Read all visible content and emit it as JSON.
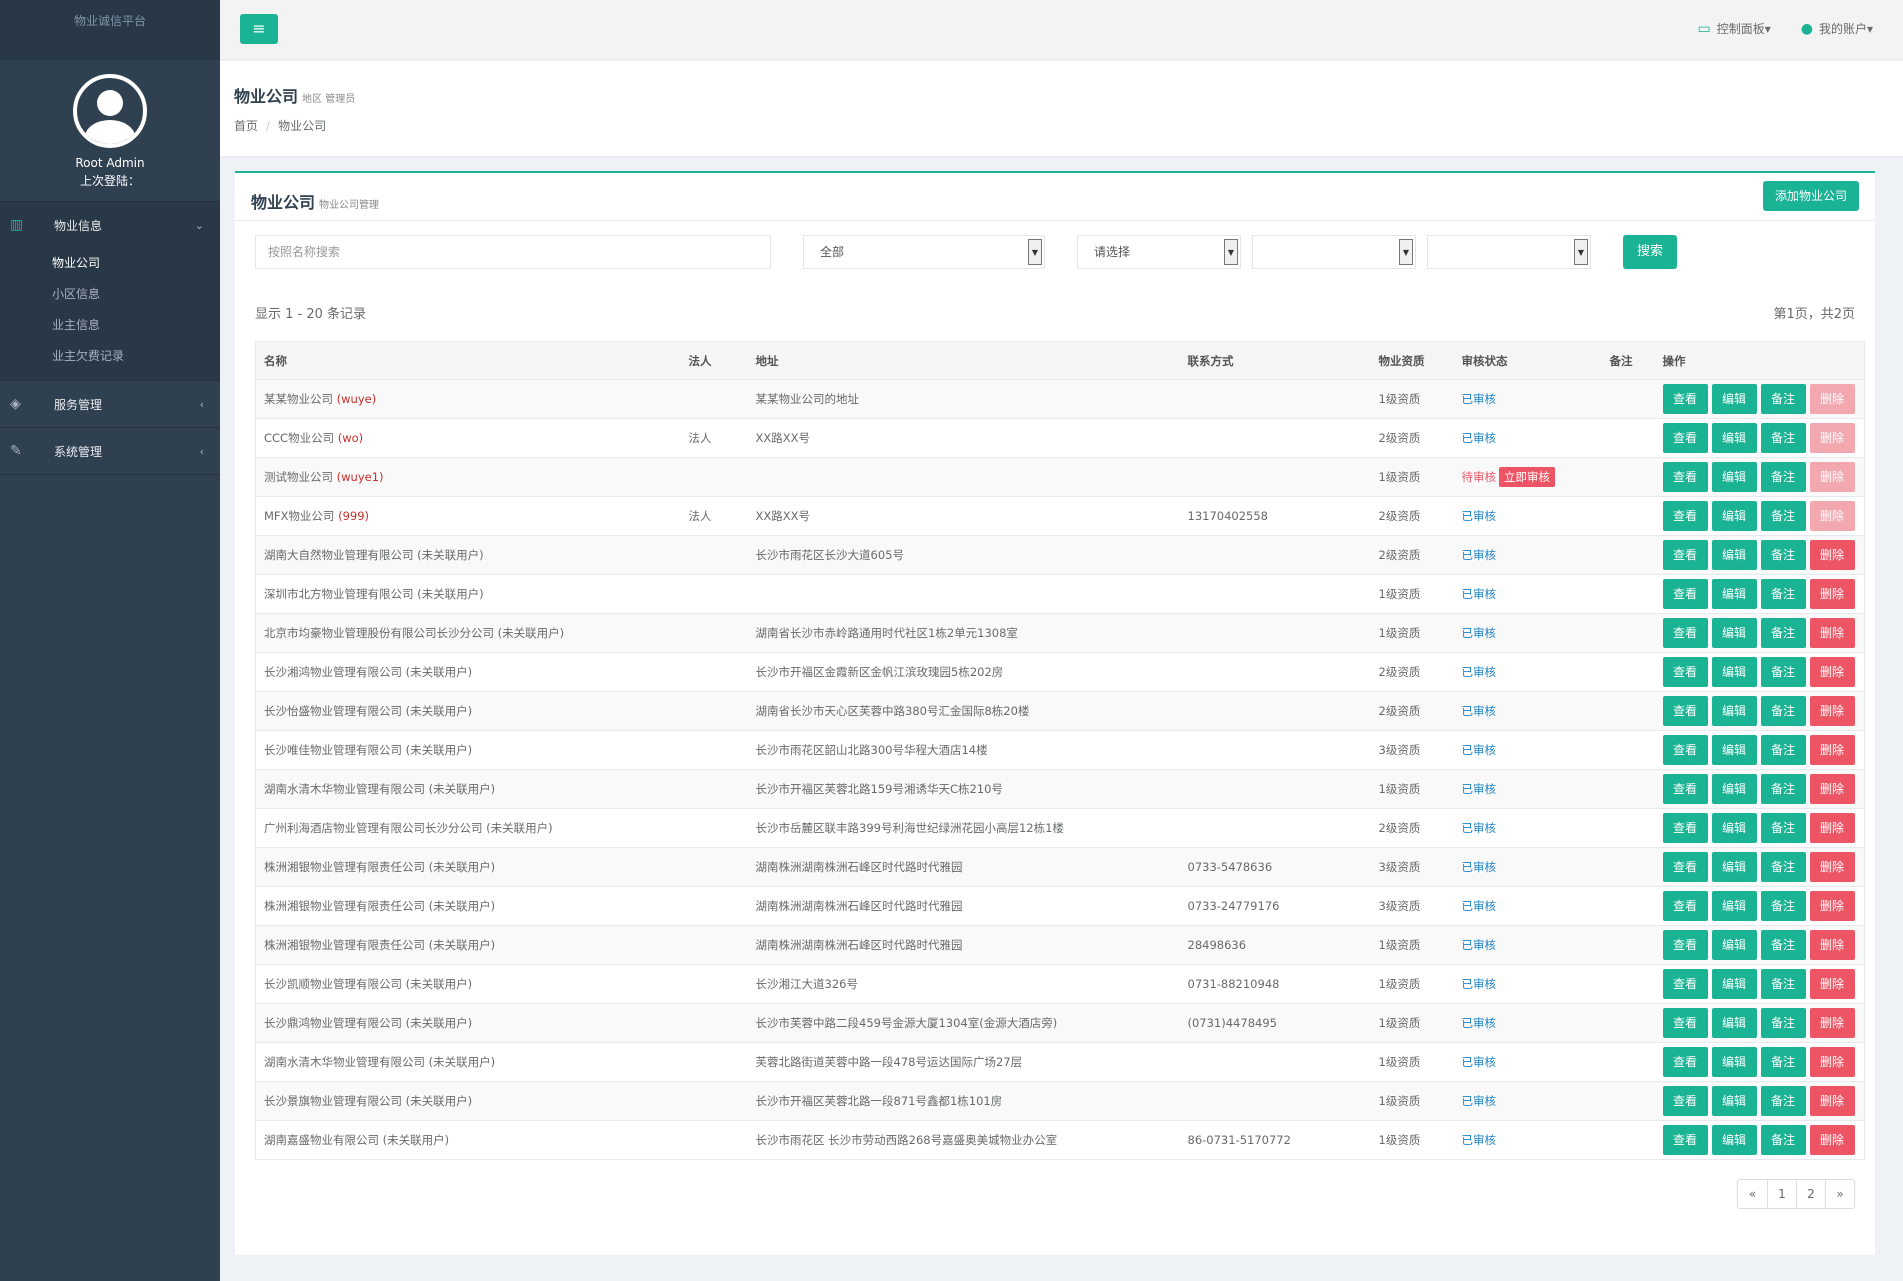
{
  "brand": "物业诚信平台",
  "profile": {
    "name": "Root Admin",
    "last_login": "上次登陆："
  },
  "nav": [
    {
      "label": "物业信息",
      "chev": "⌄",
      "children": [
        "物业公司",
        "小区信息",
        "业主信息",
        "业主欠费记录"
      ]
    },
    {
      "label": "服务管理",
      "chev": "‹"
    },
    {
      "label": "系统管理",
      "chev": "‹"
    }
  ],
  "topbar": {
    "dashboard": "控制面板▾",
    "account": "我的账户▾"
  },
  "heading": {
    "title": "物业公司",
    "subtitle": "地区 管理员",
    "crumb_home": "首页",
    "crumb_current": "物业公司"
  },
  "panel": {
    "title": "物业公司",
    "subtitle": "物业公司管理",
    "add_button": "添加物业公司"
  },
  "filters": {
    "name_placeholder": "按照名称搜索",
    "select1": "全部",
    "select2": "请选择",
    "select3": "",
    "select4": "",
    "search_button": "搜索"
  },
  "records": {
    "showing": "显示 1 - 20 条记录",
    "page_info": "第1页，共2页"
  },
  "columns": [
    "名称",
    "法人",
    "地址",
    "联系方式",
    "物业资质",
    "审核状态",
    "备注",
    "操作"
  ],
  "actions": {
    "view": "查看",
    "edit": "编辑",
    "note": "备注",
    "delete": "删除",
    "review_now": "立即审核"
  },
  "rows": [
    {
      "name": "某某物业公司",
      "code": "(wuye)",
      "legal": "",
      "address": "某某物业公司的地址",
      "contact": "",
      "level": "1级资质",
      "status": "已审核",
      "pending": false,
      "delete_disabled": true
    },
    {
      "name": "CCC物业公司",
      "code": "(wo)",
      "legal": "法人",
      "address": "XX路XX号",
      "contact": "",
      "level": "2级资质",
      "status": "已审核",
      "pending": false,
      "delete_disabled": true
    },
    {
      "name": "测试物业公司",
      "code": "(wuye1)",
      "legal": "",
      "address": "",
      "contact": "",
      "level": "1级资质",
      "status": "待审核",
      "pending": true,
      "delete_disabled": true
    },
    {
      "name": "MFX物业公司",
      "code": "(999)",
      "legal": "法人",
      "address": "XX路XX号",
      "contact": "13170402558",
      "level": "2级资质",
      "status": "已审核",
      "pending": false,
      "delete_disabled": true
    },
    {
      "name": "湖南大自然物业管理有限公司 (未关联用户)",
      "code": "",
      "legal": "",
      "address": "长沙市雨花区长沙大道605号",
      "contact": "",
      "level": "2级资质",
      "status": "已审核",
      "pending": false,
      "delete_disabled": false
    },
    {
      "name": "深圳市北方物业管理有限公司 (未关联用户)",
      "code": "",
      "legal": "",
      "address": "",
      "contact": "",
      "level": "1级资质",
      "status": "已审核",
      "pending": false,
      "delete_disabled": false
    },
    {
      "name": "北京市均豪物业管理股份有限公司长沙分公司 (未关联用户)",
      "code": "",
      "legal": "",
      "address": "湖南省长沙市赤岭路通用时代社区1栋2单元1308室",
      "contact": "",
      "level": "1级资质",
      "status": "已审核",
      "pending": false,
      "delete_disabled": false
    },
    {
      "name": "长沙湘鸿物业管理有限公司 (未关联用户)",
      "code": "",
      "legal": "",
      "address": "长沙市开福区金霞新区金帆江滨玫瑰园5栋202房",
      "contact": "",
      "level": "2级资质",
      "status": "已审核",
      "pending": false,
      "delete_disabled": false
    },
    {
      "name": "长沙怡盛物业管理有限公司 (未关联用户)",
      "code": "",
      "legal": "",
      "address": "湖南省长沙市天心区芙蓉中路380号汇金国际8栋20楼",
      "contact": "",
      "level": "2级资质",
      "status": "已审核",
      "pending": false,
      "delete_disabled": false
    },
    {
      "name": "长沙唯佳物业管理有限公司 (未关联用户)",
      "code": "",
      "legal": "",
      "address": "长沙市雨花区韶山北路300号华程大酒店14楼",
      "contact": "",
      "level": "3级资质",
      "status": "已审核",
      "pending": false,
      "delete_disabled": false
    },
    {
      "name": "湖南水清木华物业管理有限公司 (未关联用户)",
      "code": "",
      "legal": "",
      "address": "长沙市开福区芙蓉北路159号湘诱华天C栋210号",
      "contact": "",
      "level": "1级资质",
      "status": "已审核",
      "pending": false,
      "delete_disabled": false
    },
    {
      "name": "广州利海酒店物业管理有限公司长沙分公司 (未关联用户)",
      "code": "",
      "legal": "",
      "address": "长沙市岳麓区联丰路399号利海世纪绿洲花园小高层12栋1楼",
      "contact": "",
      "level": "2级资质",
      "status": "已审核",
      "pending": false,
      "delete_disabled": false
    },
    {
      "name": "株洲湘银物业管理有限责任公司 (未关联用户)",
      "code": "",
      "legal": "",
      "address": "湖南株洲湖南株洲石峰区时代路时代雅园",
      "contact": "0733-5478636",
      "level": "3级资质",
      "status": "已审核",
      "pending": false,
      "delete_disabled": false
    },
    {
      "name": "株洲湘银物业管理有限责任公司 (未关联用户)",
      "code": "",
      "legal": "",
      "address": "湖南株洲湖南株洲石峰区时代路时代雅园",
      "contact": "0733-24779176",
      "level": "3级资质",
      "status": "已审核",
      "pending": false,
      "delete_disabled": false
    },
    {
      "name": "株洲湘银物业管理有限责任公司 (未关联用户)",
      "code": "",
      "legal": "",
      "address": "湖南株洲湖南株洲石峰区时代路时代雅园",
      "contact": "28498636",
      "level": "1级资质",
      "status": "已审核",
      "pending": false,
      "delete_disabled": false
    },
    {
      "name": "长沙凯顺物业管理有限公司 (未关联用户)",
      "code": "",
      "legal": "",
      "address": "长沙湘江大道326号",
      "contact": "0731-88210948",
      "level": "1级资质",
      "status": "已审核",
      "pending": false,
      "delete_disabled": false
    },
    {
      "name": "长沙鼎鸿物业管理有限公司 (未关联用户)",
      "code": "",
      "legal": "",
      "address": "长沙市芙蓉中路二段459号金源大厦1304室(金源大酒店旁)",
      "contact": "(0731)4478495",
      "level": "1级资质",
      "status": "已审核",
      "pending": false,
      "delete_disabled": false
    },
    {
      "name": "湖南水清木华物业管理有限公司 (未关联用户)",
      "code": "",
      "legal": "",
      "address": "芙蓉北路街道芙蓉中路一段478号运达国际广场27层",
      "contact": "",
      "level": "1级资质",
      "status": "已审核",
      "pending": false,
      "delete_disabled": false
    },
    {
      "name": "长沙景旗物业管理有限公司 (未关联用户)",
      "code": "",
      "legal": "",
      "address": "长沙市开福区芙蓉北路一段871号鑫都1栋101房",
      "contact": "",
      "level": "1级资质",
      "status": "已审核",
      "pending": false,
      "delete_disabled": false
    },
    {
      "name": "湖南嘉盛物业有限公司 (未关联用户)",
      "code": "",
      "legal": "",
      "address": "长沙市雨花区 长沙市劳动西路268号嘉盛奥美城物业办公室",
      "contact": "86-0731-5170772",
      "level": "1级资质",
      "status": "已审核",
      "pending": false,
      "delete_disabled": false
    }
  ],
  "pagination": [
    "«",
    "1",
    "2",
    "»"
  ]
}
